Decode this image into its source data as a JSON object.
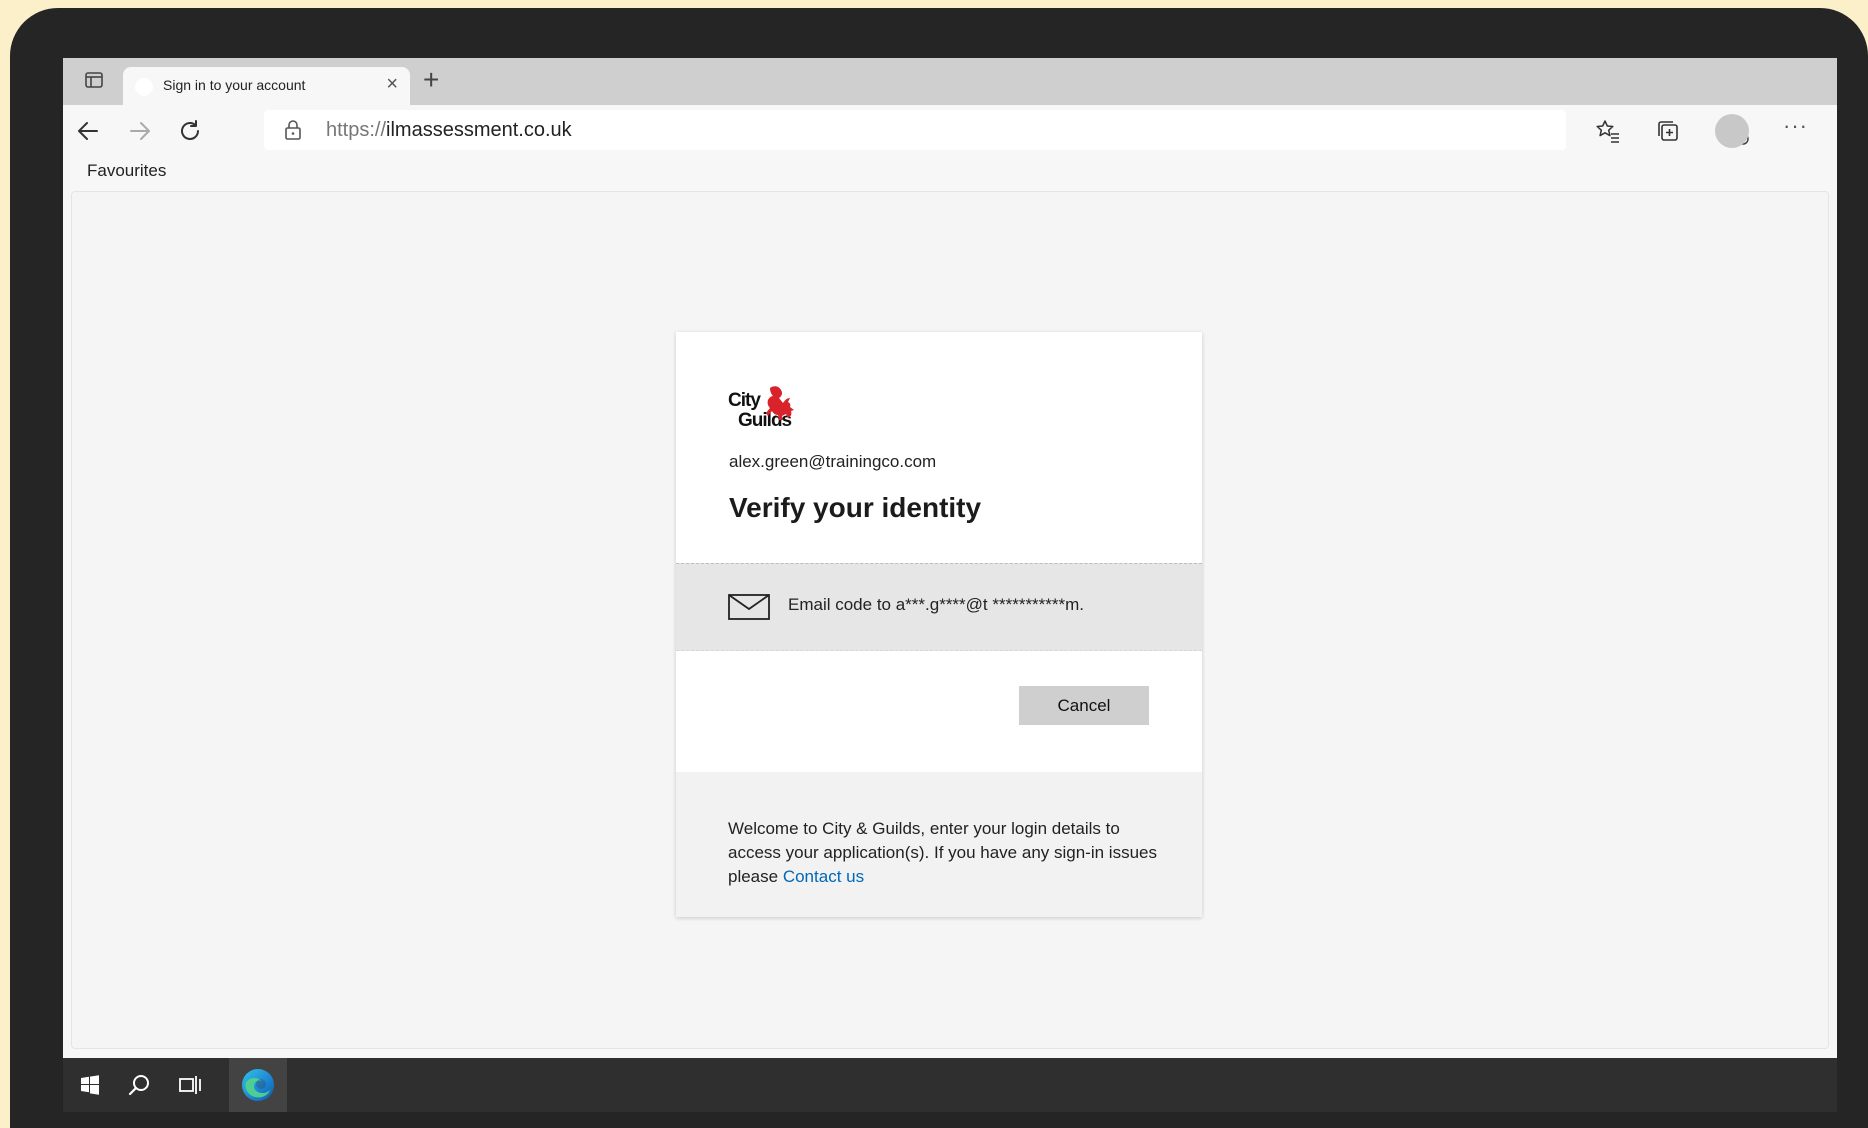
{
  "browser": {
    "tab_title": "Sign in to your account",
    "tab_close": "×",
    "new_tab": "+",
    "url_proto": "https://",
    "url_host": "ilmassessment.co.uk",
    "more": "···",
    "favourites_label": "Favourites"
  },
  "card": {
    "logo_text_top": "City",
    "logo_text_bottom": "Guilds",
    "email": "alex.green@trainingco.com",
    "heading": "Verify your identity",
    "method_label": "Email code to a***.g****@t ***********m.",
    "cancel_label": "Cancel",
    "footer_text": "Welcome to City & Guilds, enter your login details to access your application(s). If you have any sign-in issues please ",
    "contact_link": "Contact us"
  },
  "colors": {
    "link": "#0067b8",
    "brand_red": "#d8232a",
    "background": "#fbf0c9"
  },
  "icons": [
    "tab-actions-icon",
    "back-arrow-icon",
    "forward-arrow-icon",
    "refresh-icon",
    "lock-icon",
    "favorite-add-icon",
    "favorites-icon",
    "collections-icon",
    "profile-avatar",
    "more-icon",
    "mail-icon",
    "windows-start-icon",
    "search-icon",
    "task-view-icon",
    "edge-icon"
  ]
}
